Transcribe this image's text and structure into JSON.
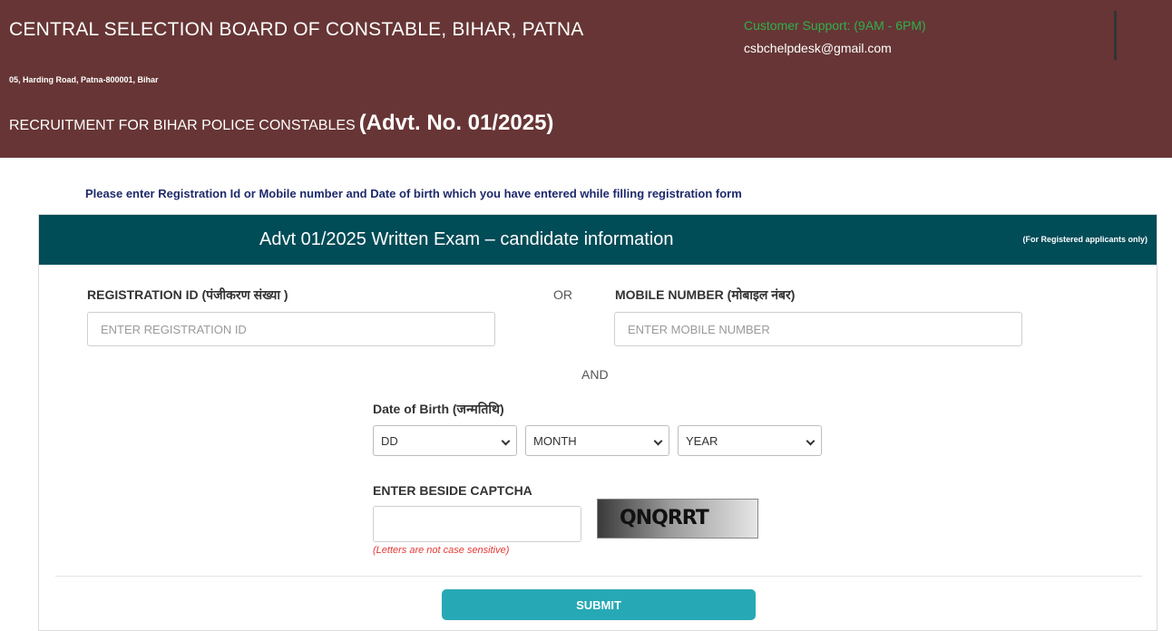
{
  "header": {
    "org_name": "CENTRAL SELECTION BOARD OF CONSTABLE, BIHAR, PATNA",
    "address": "05, Harding Road, Patna-800001, Bihar",
    "recruitment_text": "RECRUITMENT FOR BIHAR POLICE CONSTABLES",
    "advt_no": "(Advt. No. 01/2025)",
    "support_title": "Customer Support: (9AM - 6PM)",
    "support_email": "csbchelpdesk@gmail.com"
  },
  "notice": "Please enter Registration Id or Mobile number and Date of birth which you have entered while filling registration form",
  "card": {
    "title": "Advt 01/2025 Written Exam – candidate information",
    "note": "(For Registered applicants only)"
  },
  "form": {
    "registration_label": "REGISTRATION ID (पंजीकरण संख्या )",
    "registration_placeholder": "ENTER REGISTRATION ID",
    "or_text": "OR",
    "mobile_label": "MOBILE NUMBER (मोबाइल नंबर)",
    "mobile_placeholder": "ENTER MOBILE NUMBER",
    "and_text": "AND",
    "dob_label": "Date of Birth (जन्मतिथि)",
    "dob_day": "DD",
    "dob_month": "MONTH",
    "dob_year": "YEAR",
    "captcha_label": "ENTER BESIDE CAPTCHA",
    "captcha_value": "",
    "captcha_code": "QNQRRT",
    "captcha_hint": "(Letters are not case sensitive)",
    "submit_label": "SUBMIT"
  },
  "colors": {
    "header_bg": "#673535",
    "card_header_bg": "#004c57",
    "support_green": "#2eb04c",
    "submit_bg": "#26a9b5",
    "hint_red": "#e53935"
  }
}
